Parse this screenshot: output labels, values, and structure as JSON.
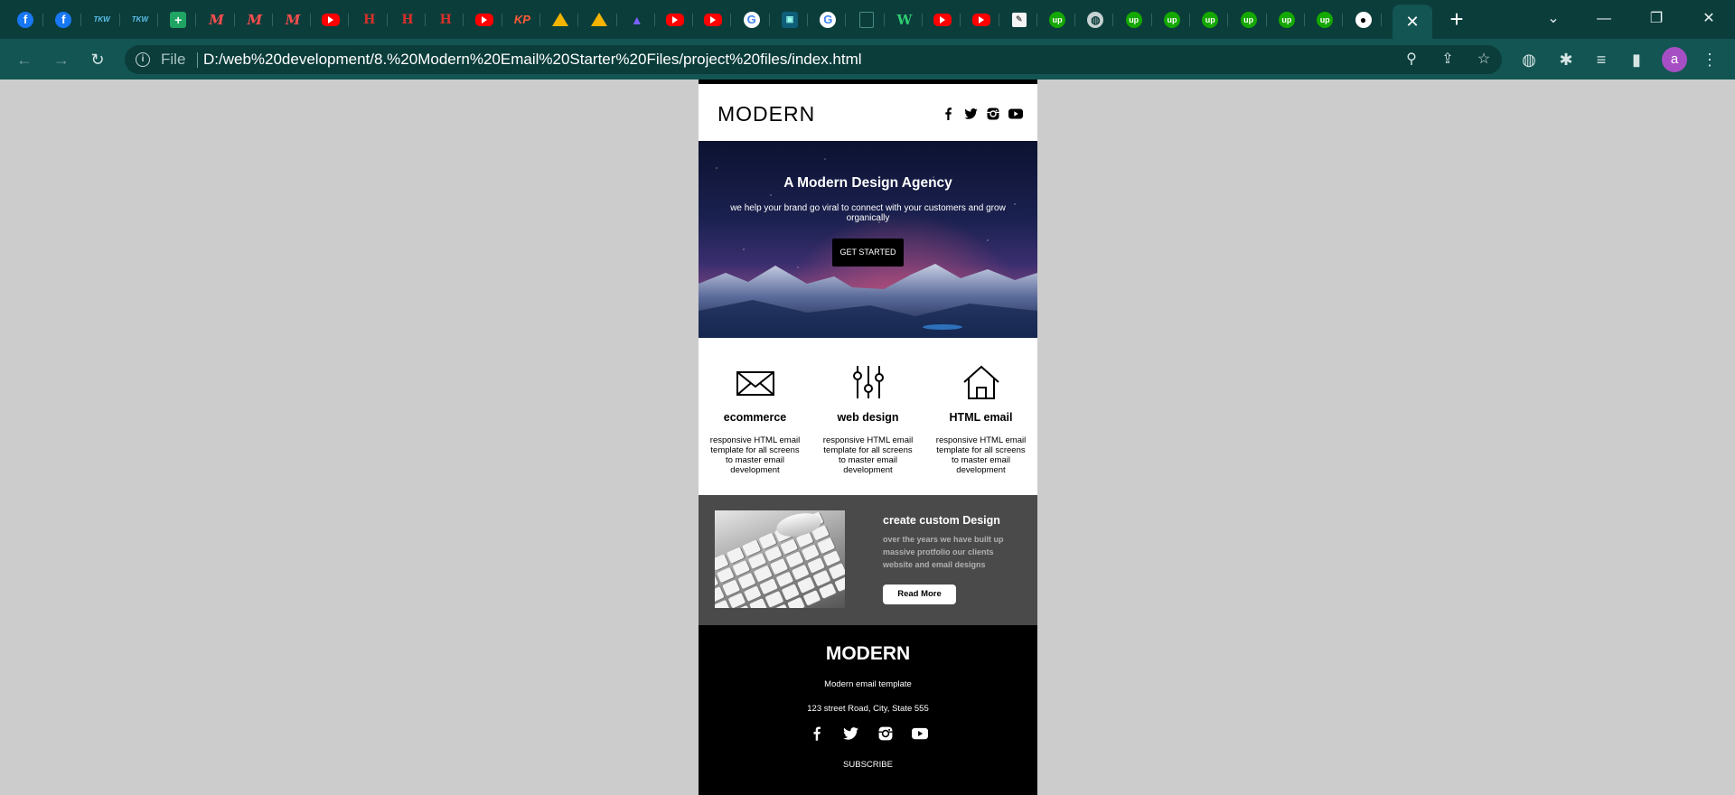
{
  "browser": {
    "tabs": [
      {
        "icon": "facebook-icon",
        "glyph": "f"
      },
      {
        "icon": "facebook-icon",
        "glyph": "f"
      },
      {
        "icon": "tkw-icon",
        "glyph": "TKW"
      },
      {
        "icon": "tkw-icon",
        "glyph": "TKW"
      },
      {
        "icon": "google-sheets-icon",
        "glyph": "+"
      },
      {
        "icon": "m-icon",
        "glyph": "M"
      },
      {
        "icon": "m-icon",
        "glyph": "M"
      },
      {
        "icon": "m-icon",
        "glyph": "M"
      },
      {
        "icon": "youtube-icon",
        "glyph": ""
      },
      {
        "icon": "hm-icon",
        "glyph": "H"
      },
      {
        "icon": "hm-icon",
        "glyph": "H"
      },
      {
        "icon": "hm-icon",
        "glyph": "H"
      },
      {
        "icon": "youtube-icon",
        "glyph": ""
      },
      {
        "icon": "kp-icon",
        "glyph": "KP"
      },
      {
        "icon": "google-drive-icon",
        "glyph": ""
      },
      {
        "icon": "google-drive-icon",
        "glyph": ""
      },
      {
        "icon": "graduation-cap-icon",
        "glyph": "▲"
      },
      {
        "icon": "youtube-icon",
        "glyph": ""
      },
      {
        "icon": "youtube-icon",
        "glyph": ""
      },
      {
        "icon": "google-icon",
        "glyph": "G"
      },
      {
        "icon": "document-icon",
        "glyph": "▣"
      },
      {
        "icon": "google-icon",
        "glyph": "G"
      },
      {
        "icon": "blank-page-icon",
        "glyph": ""
      },
      {
        "icon": "w-icon",
        "glyph": "W"
      },
      {
        "icon": "youtube-icon",
        "glyph": ""
      },
      {
        "icon": "youtube-icon",
        "glyph": ""
      },
      {
        "icon": "white-page-icon",
        "glyph": "✎"
      },
      {
        "icon": "upwork-icon",
        "glyph": "up"
      },
      {
        "icon": "globe-icon",
        "glyph": "◍"
      },
      {
        "icon": "upwork-icon",
        "glyph": "up"
      },
      {
        "icon": "upwork-icon",
        "glyph": "up"
      },
      {
        "icon": "upwork-icon",
        "glyph": "up"
      },
      {
        "icon": "upwork-icon",
        "glyph": "up"
      },
      {
        "icon": "upwork-icon",
        "glyph": "up"
      },
      {
        "icon": "upwork-icon",
        "glyph": "up"
      },
      {
        "icon": "github-icon",
        "glyph": "●"
      }
    ],
    "active_tab_close": "✕",
    "new_tab": "+",
    "window_controls": {
      "list": "⌄",
      "minimize": "—",
      "restore": "❐",
      "close": "✕"
    },
    "omnibox": {
      "scheme": "File",
      "url": "D:/web%20development/8.%20Modern%20Email%20Starter%20Files/project%20files/index.html"
    },
    "profile_initial": "a",
    "colors": {
      "frame": "#0b3d3b",
      "toolbar": "#125552",
      "avatar": "#a64fc4"
    }
  },
  "email": {
    "header": {
      "logo": "MODERN",
      "social": [
        "facebook-icon",
        "twitter-icon",
        "instagram-icon",
        "youtube-icon"
      ]
    },
    "hero": {
      "title": "A Modern Design Agency",
      "subtitle": "we help your brand go viral to connect with your customers and grow organically",
      "button": "GET STARTED"
    },
    "features": [
      {
        "icon": "envelope-icon",
        "title": "ecommerce",
        "text": "responsive HTML email template for all screens to master email development"
      },
      {
        "icon": "sliders-icon",
        "title": "web design",
        "text": "responsive HTML email template for all screens to master email development"
      },
      {
        "icon": "house-icon",
        "title": "HTML email",
        "text": "responsive HTML email template for all screens to master email development"
      }
    ],
    "promo": {
      "image": "keyboard-mouse-photo",
      "title": "create custom Design",
      "text": "over the years we have built up massive protfolio our clients website and email designs",
      "button": "Read More"
    },
    "footer": {
      "logo": "MODERN",
      "tagline": "Modern email template",
      "address": "123 street Road, City, State 555",
      "social": [
        "facebook-icon",
        "twitter-icon",
        "instagram-icon",
        "youtube-icon"
      ],
      "subscribe": "SUBSCRIBE"
    },
    "colors": {
      "page_bg": "#cccccc",
      "promo_bg": "#4a4a4a",
      "footer_bg": "#000000"
    }
  }
}
